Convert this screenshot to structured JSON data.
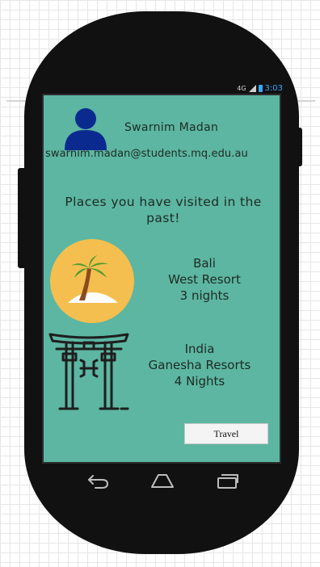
{
  "status_bar": {
    "signal": "4G",
    "time": "3:03"
  },
  "profile": {
    "avatar_icon": "user-avatar-icon",
    "name": "Swarnim Madan",
    "email": "swarnim.madan@students.mq.edu.au"
  },
  "heading": "Places you have visited in the past!",
  "places": [
    {
      "icon": "palm-island-icon",
      "country": "Bali",
      "resort": "West Resort",
      "stay": "3 nights"
    },
    {
      "icon": "torii-gate-icon",
      "country": "India",
      "resort": "Ganesha Resorts",
      "stay": "4 Nights"
    }
  ],
  "travel_button": "Travel",
  "nav_icons": [
    "back-icon",
    "home-icon",
    "recent-apps-icon"
  ],
  "colors": {
    "screen_bg": "#5cb6a2",
    "avatar": "#0b2a8f",
    "sun": "#f5bf4f",
    "status": "#3aa7ff"
  }
}
